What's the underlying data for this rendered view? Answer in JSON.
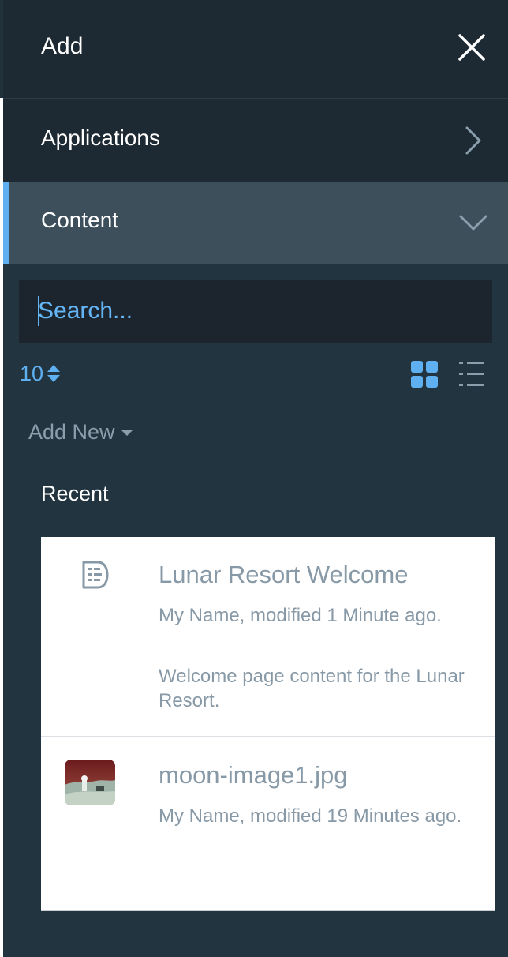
{
  "header": {
    "title": "Add"
  },
  "sections": {
    "applications": {
      "label": "Applications"
    },
    "content": {
      "label": "Content"
    }
  },
  "search": {
    "placeholder": "Search..."
  },
  "toolbar": {
    "page_size": "10"
  },
  "add_new": {
    "label": "Add New"
  },
  "recent": {
    "title": "Recent",
    "items": [
      {
        "title": "Lunar Resort Welcome",
        "meta": "My Name, modified 1 Minute ago.",
        "description": "Welcome page content for the Lunar Resort.",
        "icon": "web-content-icon"
      },
      {
        "title": "moon-image1.jpg",
        "meta": "My Name, modified 19 Minutes ago.",
        "icon": "image-thumbnail"
      }
    ]
  },
  "colors": {
    "panel_bg": "#22343f",
    "header_bg": "#1e2a33",
    "active_row_bg": "#3e4f5c",
    "accent": "#5fb0f0",
    "muted_text": "#8799a6"
  }
}
